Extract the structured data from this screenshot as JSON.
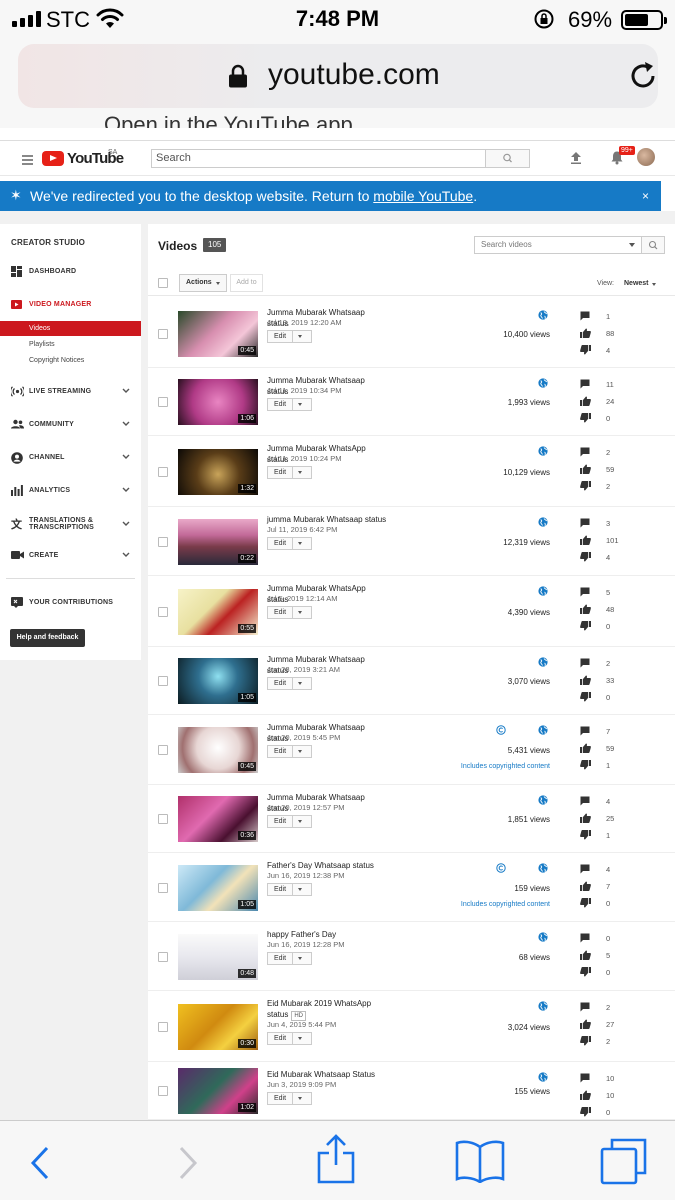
{
  "status_bar": {
    "carrier": "STC",
    "time": "7:48 PM",
    "battery": "69%",
    "battery_level": 0.69
  },
  "browser": {
    "url": "youtube.com",
    "open_in_app_hint": "Open in the YouTube app"
  },
  "masthead": {
    "logo_text": "YouTube",
    "region": "SA",
    "search_placeholder": "Search",
    "notifications": "99+"
  },
  "banner": {
    "text": "We've redirected you to the desktop website. Return to ",
    "link": "mobile YouTube",
    "suffix": ".",
    "close": "×"
  },
  "sidebar": {
    "title": "CREATOR STUDIO",
    "dashboard": "DASHBOARD",
    "video_manager": "VIDEO MANAGER",
    "sub_videos": "Videos",
    "sub_playlists": "Playlists",
    "sub_copyright": "Copyright Notices",
    "live": "LIVE STREAMING",
    "community": "COMMUNITY",
    "channel": "CHANNEL",
    "analytics": "ANALYTICS",
    "translations_1": "TRANSLATIONS &",
    "translations_2": "TRANSCRIPTIONS",
    "create": "CREATE",
    "contributions": "YOUR CONTRIBUTIONS",
    "help": "Help and feedback"
  },
  "main": {
    "title": "Videos",
    "count": "105",
    "search_placeholder": "Search videos",
    "actions": "Actions",
    "add_to": "Add to",
    "view_label": "View:",
    "sort": "Newest",
    "edit_label": "Edit",
    "copyright_note": "Includes copyrighted content"
  },
  "videos": [
    {
      "title": "Jumma Mubarak Whatsaap status",
      "date": "Jul 19, 2019 12:20 AM",
      "duration": "0:45",
      "views": "10,400 views",
      "comments": "1",
      "likes": "88",
      "dislikes": "4",
      "copyright": false,
      "hd": false
    },
    {
      "title": "Jumma Mubarak Whatsaap status",
      "date": "Jul 11, 2019 10:34 PM",
      "duration": "1:06",
      "views": "1,993 views",
      "comments": "11",
      "likes": "24",
      "dislikes": "0",
      "copyright": false,
      "hd": false
    },
    {
      "title": "Jumma Mubarak WhatsApp status",
      "date": "Jul 11, 2019 10:24 PM",
      "duration": "1:32",
      "views": "10,129 views",
      "comments": "2",
      "likes": "59",
      "dislikes": "2",
      "copyright": false,
      "hd": false
    },
    {
      "title": "jumma Mubarak Whatsaap status",
      "date": "Jul 11, 2019 6:42 PM",
      "duration": "0:22",
      "views": "12,319 views",
      "comments": "3",
      "likes": "101",
      "dislikes": "4",
      "copyright": false,
      "hd": false
    },
    {
      "title": "Jumma Mubarak WhatsApp status",
      "date": "Jul 5, 2019 12:14 AM",
      "duration": "0:55",
      "views": "4,390 views",
      "comments": "5",
      "likes": "48",
      "dislikes": "0",
      "copyright": false,
      "hd": false
    },
    {
      "title": "Jumma Mubarak Whatsaap status",
      "date": "Jun 28, 2019 3:21 AM",
      "duration": "1:05",
      "views": "3,070 views",
      "comments": "2",
      "likes": "33",
      "dislikes": "0",
      "copyright": false,
      "hd": false
    },
    {
      "title": "Jumma Mubarak Whatsaap status",
      "date": "Jun 20, 2019 5:45 PM",
      "duration": "0:45",
      "views": "5,431 views",
      "comments": "7",
      "likes": "59",
      "dislikes": "1",
      "copyright": true,
      "hd": false
    },
    {
      "title": "Jumma Mubarak Whatsaap status",
      "date": "Jun 20, 2019 12:57 PM",
      "duration": "0:36",
      "views": "1,851 views",
      "comments": "4",
      "likes": "25",
      "dislikes": "1",
      "copyright": false,
      "hd": false
    },
    {
      "title": "Father's Day Whatsaap status",
      "date": "Jun 16, 2019 12:38 PM",
      "duration": "1:05",
      "views": "159 views",
      "comments": "4",
      "likes": "7",
      "dislikes": "0",
      "copyright": true,
      "hd": false
    },
    {
      "title": "happy Father's Day",
      "date": "Jun 16, 2019 12:28 PM",
      "duration": "0:48",
      "views": "68 views",
      "comments": "0",
      "likes": "5",
      "dislikes": "0",
      "copyright": false,
      "hd": false
    },
    {
      "title": "Eid Mubarak 2019 WhatsApp status",
      "date": "Jun 4, 2019 5:44 PM",
      "duration": "0:30",
      "views": "3,024 views",
      "comments": "2",
      "likes": "27",
      "dislikes": "2",
      "copyright": false,
      "hd": true,
      "hd_label": "HD"
    },
    {
      "title": "Eid Mubarak Whatsaap Status",
      "date": "Jun 3, 2019 9:09 PM",
      "duration": "1:02",
      "views": "155 views",
      "comments": "10",
      "likes": "10",
      "dislikes": "0",
      "copyright": false,
      "hd": false
    }
  ],
  "colors": {
    "yt_red": "#e62117",
    "banner_blue": "#167ac6",
    "nav_red": "#cc181e",
    "ios_blue": "#1a73e8"
  }
}
